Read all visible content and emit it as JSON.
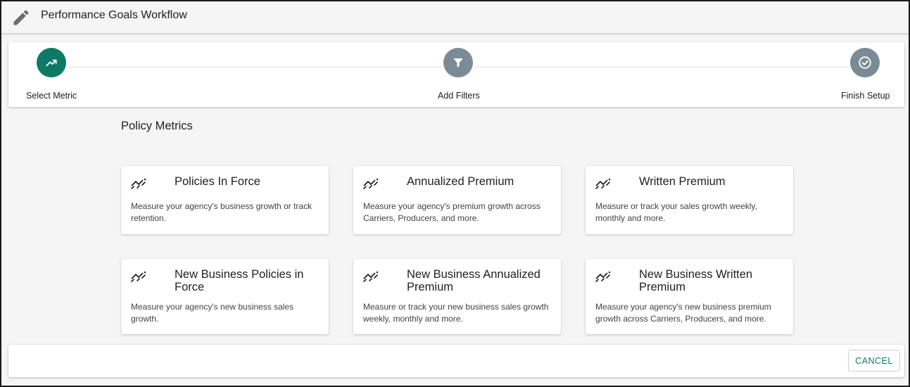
{
  "header": {
    "title": "Performance Goals Workflow",
    "icon": "pencil-icon"
  },
  "stepper": {
    "steps": [
      {
        "label": "Select Metric",
        "icon": "trending-up-icon",
        "state": "active"
      },
      {
        "label": "Add Filters",
        "icon": "filter-icon",
        "state": "inactive"
      },
      {
        "label": "Finish Setup",
        "icon": "check-circle-icon",
        "state": "inactive"
      }
    ]
  },
  "main": {
    "section_title": "Policy Metrics",
    "cards": [
      {
        "title": "Policies In Force",
        "description": "Measure your agency's business growth or track retention.",
        "icon": "sparkline-icon"
      },
      {
        "title": "Annualized Premium",
        "description": "Measure your agency's premium growth across Carriers, Producers, and more.",
        "icon": "sparkline-icon"
      },
      {
        "title": "Written Premium",
        "description": "Measure or track your sales growth weekly, monthly and more.",
        "icon": "sparkline-icon"
      },
      {
        "title": "New Business Policies in Force",
        "description": "Measure your agency's new business sales growth.",
        "icon": "sparkline-icon"
      },
      {
        "title": "New Business Annualized Premium",
        "description": "Measure or track your new business sales growth weekly, monthly and more.",
        "icon": "sparkline-icon"
      },
      {
        "title": "New Business Written Premium",
        "description": "Measure your agency's new business premium growth across Carriers, Producers, and more.",
        "icon": "sparkline-icon"
      }
    ]
  },
  "footer": {
    "cancel_label": "CANCEL"
  },
  "colors": {
    "accent": "#0e7a65",
    "inactive_step": "#7a8b95",
    "background": "#f5f5f5"
  }
}
